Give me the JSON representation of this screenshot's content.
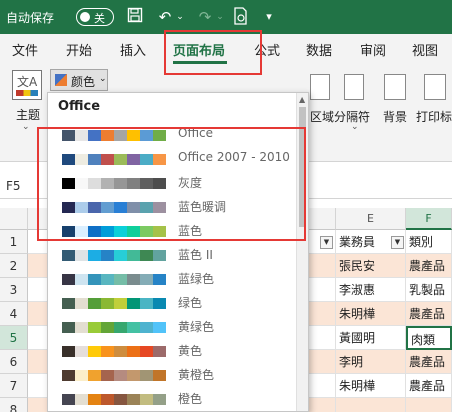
{
  "titlebar": {
    "autosave_label": "自动保存",
    "toggle_state": "关",
    "icons": [
      "save-icon",
      "undo-icon",
      "redo-icon",
      "print-preview-icon",
      "customize-icon"
    ]
  },
  "tabs": [
    {
      "label": "文件"
    },
    {
      "label": "开始"
    },
    {
      "label": "插入"
    },
    {
      "label": "页面布局",
      "active": true
    },
    {
      "label": "公式"
    },
    {
      "label": "数据"
    },
    {
      "label": "审阅"
    },
    {
      "label": "视图"
    }
  ],
  "ribbon": {
    "theme_label": "主题",
    "colors_label": "颜色",
    "print_area_label": "区域",
    "breaks_label": "分隔符",
    "background_label": "背景",
    "print_titles_label": "打印标"
  },
  "formula_bar": {
    "name_box": "F5"
  },
  "grid": {
    "col_headers": [
      "E",
      "F"
    ],
    "header_row": {
      "salesperson": "業務員",
      "category": "類別"
    },
    "row_numbers": [
      "1",
      "2",
      "3",
      "4",
      "5",
      "6",
      "7",
      "8"
    ],
    "rows": [
      {
        "salesperson": "張民安",
        "category": "農產品"
      },
      {
        "salesperson": "李淑惠",
        "category": "乳製品"
      },
      {
        "salesperson": "朱明樺",
        "category": "農產品"
      },
      {
        "salesperson": "黃國明",
        "category": "肉類"
      },
      {
        "salesperson": "李明",
        "category": "農產品"
      },
      {
        "salesperson": "朱明樺",
        "category": "農產品"
      },
      {
        "salesperson": "",
        "category": ""
      }
    ]
  },
  "dropdown": {
    "header": "Office",
    "options": [
      {
        "label": "Office",
        "colors": [
          "#44546a",
          "#e7e6e6",
          "#4472c4",
          "#ed7d31",
          "#a5a5a5",
          "#ffc000",
          "#5b9bd5",
          "#70ad47"
        ]
      },
      {
        "label": "Office 2007 - 2010",
        "colors": [
          "#1f497d",
          "#eeece1",
          "#4f81bd",
          "#c0504d",
          "#9bbb59",
          "#8064a2",
          "#4bacc6",
          "#f79646"
        ]
      },
      {
        "label": "灰度",
        "colors": [
          "#000000",
          "#f8f8f8",
          "#dddddd",
          "#b2b2b2",
          "#969696",
          "#808080",
          "#5f5f5f",
          "#4d4d4d"
        ]
      },
      {
        "label": "蓝色暖调",
        "colors": [
          "#242852",
          "#acccea",
          "#4a66ac",
          "#629dd1",
          "#297fd5",
          "#7f8fa9",
          "#5aa2ae",
          "#9d90a0"
        ]
      },
      {
        "label": "蓝色",
        "colors": [
          "#17406d",
          "#dbefff",
          "#0f6fc6",
          "#009dd9",
          "#0bd0d9",
          "#10cf9b",
          "#7cca62",
          "#a5c249"
        ]
      },
      {
        "label": "蓝色 II",
        "colors": [
          "#335b74",
          "#dfe3e5",
          "#1cade4",
          "#2683c6",
          "#27ced7",
          "#42ba97",
          "#3e8853",
          "#62a39f"
        ]
      },
      {
        "label": "蓝绿色",
        "colors": [
          "#373545",
          "#cee4f0",
          "#3494ba",
          "#58b6c0",
          "#75bda7",
          "#7a8c8e",
          "#84acb6",
          "#2683c6"
        ]
      },
      {
        "label": "绿色",
        "colors": [
          "#455f51",
          "#e3ded1",
          "#549e39",
          "#8ab833",
          "#c0cf3a",
          "#029676",
          "#4ab5c4",
          "#0989b1"
        ]
      },
      {
        "label": "黄绿色",
        "colors": [
          "#455f51",
          "#e3ded1",
          "#99cb38",
          "#63a537",
          "#37a76f",
          "#44c1a3",
          "#4eb3cf",
          "#51c3f9"
        ]
      },
      {
        "label": "黄色",
        "colors": [
          "#39302a",
          "#e5dedb",
          "#ffca08",
          "#f8931d",
          "#ce8d3e",
          "#ec7016",
          "#e64823",
          "#9c6a6a"
        ]
      },
      {
        "label": "黄橙色",
        "colors": [
          "#4e3b30",
          "#fbeec9",
          "#f0a22e",
          "#a5644e",
          "#b58b80",
          "#c3986d",
          "#a19574",
          "#c17529"
        ]
      },
      {
        "label": "橙色",
        "colors": [
          "#454551",
          "#e3ded1",
          "#e48312",
          "#bd582c",
          "#865640",
          "#9b8357",
          "#c2bc80",
          "#94a088"
        ]
      }
    ]
  }
}
